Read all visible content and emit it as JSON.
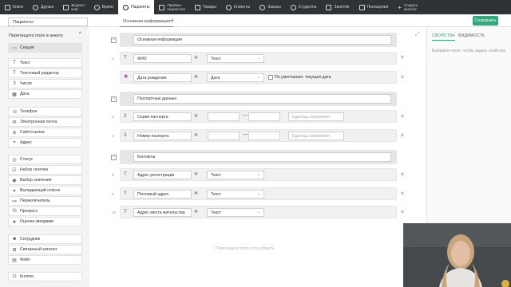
{
  "nav": [
    {
      "label": "Книги",
      "icon": "book-icon"
    },
    {
      "label": "Друзья",
      "icon": "friends-icon"
    },
    {
      "label": "Выдача",
      "label2": "книг",
      "icon": "handout-icon"
    },
    {
      "label": "Врачи",
      "icon": "doctor-icon"
    },
    {
      "label": "Пациенты",
      "icon": "patient-icon"
    },
    {
      "label": "Приемы",
      "label2": "пациентов",
      "icon": "appointment-icon"
    },
    {
      "label": "Товары",
      "icon": "goods-icon"
    },
    {
      "label": "Клиенты",
      "icon": "clients-icon"
    },
    {
      "label": "Заказы",
      "icon": "orders-icon"
    },
    {
      "label": "Студенты",
      "icon": "students-icon"
    },
    {
      "label": "Занятия",
      "icon": "lessons-icon"
    },
    {
      "label": "Посещения",
      "icon": "visits-icon"
    },
    {
      "label": "Создать",
      "label2": "каталог",
      "icon": "plus-icon"
    }
  ],
  "form_name": "Пациенты",
  "tab_main": "Основная информация",
  "tab_add": "+",
  "save_label": "Сохранить",
  "sidebar": {
    "heading": "Перетащите поле в анкету",
    "chevron": "^",
    "items": [
      {
        "label": "Секция",
        "icon": "▭"
      },
      {
        "label": "Текст",
        "icon": "T"
      },
      {
        "label": "Текстовый редактор",
        "icon": "T"
      },
      {
        "label": "Число",
        "icon": "3"
      },
      {
        "label": "Дата",
        "icon": "▦"
      },
      {
        "label": "Телефон",
        "icon": "☏"
      },
      {
        "label": "Электронная почта",
        "icon": "✉"
      },
      {
        "label": "Сайт/ссылка",
        "icon": "⊘"
      },
      {
        "label": "Адрес",
        "icon": "⌖"
      },
      {
        "label": "Статус",
        "icon": "◎"
      },
      {
        "label": "Набор галочек",
        "icon": "☑"
      },
      {
        "label": "Выбор значения",
        "icon": "◉"
      },
      {
        "label": "Выпадающий список",
        "icon": "▾"
      },
      {
        "label": "Переключатель",
        "icon": "⊶"
      },
      {
        "label": "Прогресс",
        "icon": "%"
      },
      {
        "label": "Оценка звездами",
        "icon": "★"
      },
      {
        "label": "Сотрудник",
        "icon": "☻"
      },
      {
        "label": "Связанный каталог",
        "icon": "⊞"
      },
      {
        "label": "Файл",
        "icon": "▤"
      },
      {
        "label": "Кнопка",
        "icon": "⏻"
      }
    ]
  },
  "sections": [
    {
      "name": "Основная информация"
    },
    {
      "name": "Паспортные данные"
    },
    {
      "name": "Контакты"
    }
  ],
  "fields": [
    {
      "num": "2",
      "name": "ФИО",
      "type": "Текст"
    },
    {
      "name": "Дата рождения",
      "type": "Дата",
      "checkbox_label": "По умолчанию: текущая дата"
    },
    {
      "num": "3",
      "name": "Серия паспорта",
      "unit_placeholder": "Единица измерения"
    },
    {
      "num": "3",
      "name": "Номер паспорта",
      "unit_placeholder": "Единица измерения"
    },
    {
      "num": "8",
      "name": "Адрес регистрации",
      "type": "Текст"
    },
    {
      "num": "9",
      "name": "Почтовый адрес",
      "type": "Текст"
    },
    {
      "num": "10",
      "name": "Адрес места жительства",
      "type": "Текст"
    }
  ],
  "dash": "—",
  "drop_hint": "Перетащите поля в эту область",
  "right": {
    "tab_props": "СВОЙСТВА",
    "tab_vis": "ВИДИМОСТЬ",
    "hint": "Выберите поле, чтобы задать свойства"
  }
}
